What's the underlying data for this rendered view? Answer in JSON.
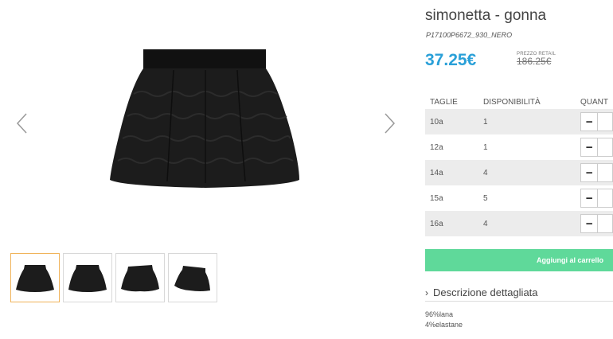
{
  "product": {
    "title": "simonetta - gonna",
    "sku": "P17100P6672_930_NERO",
    "price": "37.25€",
    "retail_label": "PREZZO RETAIL",
    "retail_price": "186.25€"
  },
  "sizes_table": {
    "headers": [
      "TAGLIE",
      "DISPONIBILITÀ",
      "QUANT"
    ],
    "rows": [
      {
        "size": "10a",
        "availability": "1"
      },
      {
        "size": "12a",
        "availability": "1"
      },
      {
        "size": "14a",
        "availability": "4"
      },
      {
        "size": "15a",
        "availability": "5"
      },
      {
        "size": "16a",
        "availability": "4"
      }
    ],
    "decrement_symbol": "−"
  },
  "cart": {
    "label": "Aggiungi al carrello"
  },
  "description": {
    "toggle_label": "Descrizione dettagliata",
    "lines": [
      "96%lana",
      "4%elastane"
    ]
  },
  "colors": {
    "price": "#2aa0d8",
    "cart_button": "#5fd99a",
    "active_thumb_border": "#f0b35a",
    "row_shade": "#ececec"
  },
  "icons": {
    "prev": "chevron-left-icon",
    "next": "chevron-right-icon",
    "expand": "chevron-right-icon"
  }
}
